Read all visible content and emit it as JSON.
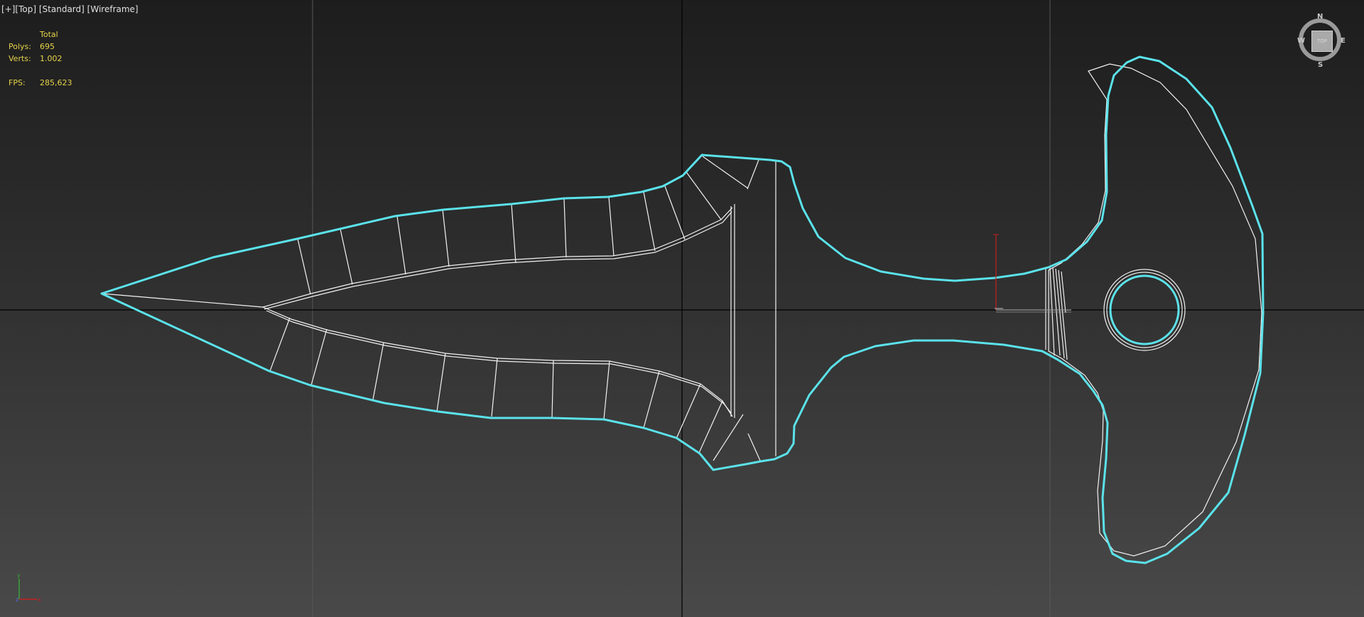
{
  "viewport": {
    "menu": "[+]",
    "view": "[Top]",
    "shading_mode": "[Standard]",
    "display_mode": "[Wireframe]"
  },
  "stats": {
    "header": "Total",
    "polys_label": "Polys:",
    "polys_value": "695",
    "verts_label": "Verts:",
    "verts_value": "1.002",
    "fps_label": "FPS:",
    "fps_value": "285,623"
  },
  "viewcube": {
    "face": "TOP",
    "north": "N",
    "south": "S",
    "east": "E",
    "west": "W"
  },
  "colors": {
    "selection_outline": "#5be2ea",
    "wireframe": "#f2f2f2",
    "home_grid": "#000000",
    "stats_text": "#e6d34a",
    "gizmo_y": "#c62020",
    "gizmo_x": "#9a9a9a"
  },
  "icons": {
    "axis_tripod": "axis-tripod-icon",
    "transform_gizmo": "transform-gizmo-icon",
    "viewcube": "viewcube-icon"
  }
}
